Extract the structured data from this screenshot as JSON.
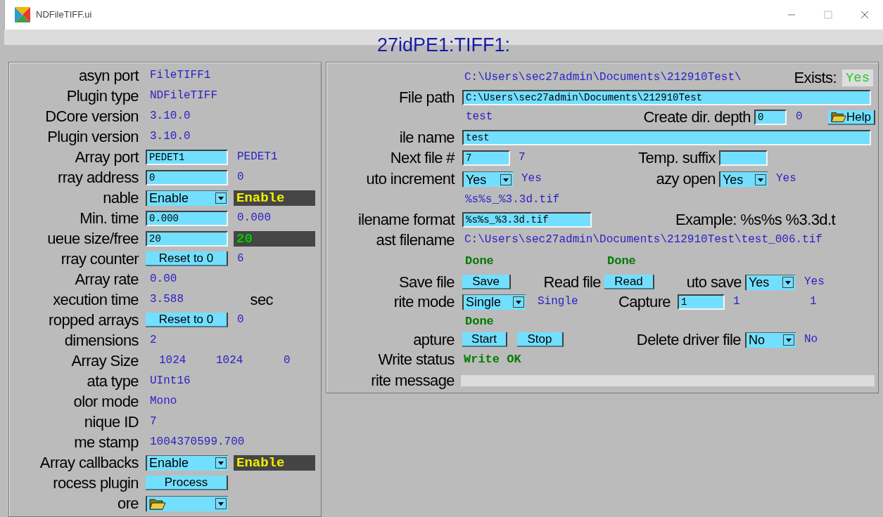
{
  "window": {
    "title": "NDFileTIFF.ui"
  },
  "header": {
    "text": "27idPE1:TIFF1:"
  },
  "left_panel": {
    "rows": [
      {
        "label": "asyn port",
        "items": [
          {
            "kind": "readback",
            "text": "FileTIFF1"
          }
        ]
      },
      {
        "label": "Plugin type",
        "items": [
          {
            "kind": "readback",
            "text": "NDFileTIFF"
          }
        ]
      },
      {
        "label": "DCore version",
        "items": [
          {
            "kind": "readback",
            "text": "3.10.0"
          }
        ]
      },
      {
        "label": "Plugin version",
        "items": [
          {
            "kind": "readback",
            "text": "3.10.0"
          }
        ]
      },
      {
        "label": "Array port",
        "items": [
          {
            "kind": "input",
            "value": "PEDET1"
          },
          {
            "kind": "readback",
            "text": "PEDET1"
          }
        ]
      },
      {
        "label": "rray address",
        "items": [
          {
            "kind": "input",
            "value": "0"
          },
          {
            "kind": "readback",
            "text": "0"
          }
        ]
      },
      {
        "label": "nable",
        "items": [
          {
            "kind": "menu",
            "value": "Enable"
          },
          {
            "kind": "dark",
            "text": "Enable",
            "color": "#f0f000"
          }
        ]
      },
      {
        "label": "Min. time",
        "items": [
          {
            "kind": "input",
            "value": "0.000"
          },
          {
            "kind": "readback",
            "text": "0.000"
          }
        ]
      },
      {
        "label": "ueue size/free",
        "items": [
          {
            "kind": "input",
            "value": "20"
          },
          {
            "kind": "dark",
            "text": "20",
            "color": "#00c800"
          }
        ]
      },
      {
        "label": "rray counter",
        "items": [
          {
            "kind": "button",
            "text": "Reset to 0"
          },
          {
            "kind": "readback",
            "text": "6"
          }
        ]
      },
      {
        "label": "Array rate",
        "items": [
          {
            "kind": "readback",
            "text": "0.00"
          }
        ]
      },
      {
        "label": "xecution time",
        "items": [
          {
            "kind": "readback",
            "text": "3.588"
          },
          {
            "kind": "label",
            "text": "sec"
          }
        ]
      },
      {
        "label": "ropped arrays",
        "items": [
          {
            "kind": "button",
            "text": "Reset to 0"
          },
          {
            "kind": "readback",
            "text": "0"
          }
        ]
      },
      {
        "label": "dimensions",
        "items": [
          {
            "kind": "readback",
            "text": "2"
          }
        ]
      },
      {
        "label": "Array Size",
        "items": [
          {
            "kind": "readback",
            "text": "1024"
          },
          {
            "kind": "readback",
            "text": "1024"
          },
          {
            "kind": "readback",
            "text": "0"
          }
        ]
      },
      {
        "label": "ata type",
        "items": [
          {
            "kind": "readback",
            "text": "UInt16"
          }
        ]
      },
      {
        "label": "olor mode",
        "items": [
          {
            "kind": "readback",
            "text": "Mono"
          }
        ]
      },
      {
        "label": "nique ID",
        "items": [
          {
            "kind": "readback",
            "text": "7"
          }
        ]
      },
      {
        "label": "me stamp",
        "items": [
          {
            "kind": "readback",
            "text": "1004370599.700"
          }
        ]
      },
      {
        "label": "Array callbacks",
        "items": [
          {
            "kind": "menu",
            "value": "Enable"
          },
          {
            "kind": "dark",
            "text": "Enable",
            "color": "#f0f000"
          }
        ]
      },
      {
        "label": "rocess plugin",
        "items": [
          {
            "kind": "button",
            "text": "Process"
          }
        ]
      },
      {
        "label": "ore",
        "items": [
          {
            "kind": "folder-menu"
          }
        ]
      }
    ]
  },
  "right_panel": {
    "rows": [
      {
        "label": "",
        "items": [
          {
            "kind": "readback",
            "text": "C:\\Users\\sec27admin\\Documents\\212910Test\\"
          },
          {
            "kind": "label",
            "text": "Exists:"
          },
          {
            "kind": "indicator",
            "text": "Yes"
          }
        ]
      },
      {
        "label": "File path",
        "items": [
          {
            "kind": "input",
            "value": "C:\\Users\\sec27admin\\Documents\\212910Test"
          }
        ]
      },
      {
        "label": "",
        "items": [
          {
            "kind": "readback",
            "text": "test"
          },
          {
            "kind": "label",
            "text": "Create dir. depth"
          },
          {
            "kind": "input",
            "value": "0"
          },
          {
            "kind": "readback",
            "text": "0"
          },
          {
            "kind": "help-button",
            "text": "Help"
          }
        ]
      },
      {
        "label": "ile name",
        "items": [
          {
            "kind": "input",
            "value": "test"
          }
        ]
      },
      {
        "label": "Next file #",
        "items": [
          {
            "kind": "input",
            "value": "7"
          },
          {
            "kind": "readback",
            "text": "7"
          },
          {
            "kind": "label",
            "text": "Temp. suffix"
          },
          {
            "kind": "input",
            "value": ""
          }
        ]
      },
      {
        "label": "uto increment",
        "items": [
          {
            "kind": "menu",
            "value": "Yes"
          },
          {
            "kind": "readback",
            "text": "Yes"
          },
          {
            "kind": "label",
            "text": "azy open"
          },
          {
            "kind": "menu",
            "value": "Yes"
          },
          {
            "kind": "readback",
            "text": "Yes"
          }
        ]
      },
      {
        "label": "",
        "items": [
          {
            "kind": "readback",
            "text": "%s%s_%3.3d.tif"
          }
        ]
      },
      {
        "label": "ilename format",
        "items": [
          {
            "kind": "input",
            "value": "%s%s_%3.3d.tif"
          },
          {
            "kind": "label",
            "text": "Example: %s%s  %3.3d.t"
          }
        ]
      },
      {
        "label": "ast filename",
        "items": [
          {
            "kind": "readback",
            "text": "C:\\Users\\sec27admin\\Documents\\212910Test\\test_006.tif"
          }
        ]
      },
      {
        "label": "",
        "items": [
          {
            "kind": "status",
            "text": "Done"
          },
          {
            "kind": "status",
            "text": "Done"
          }
        ]
      },
      {
        "label": "Save file",
        "items": [
          {
            "kind": "button",
            "text": "Save"
          },
          {
            "kind": "label",
            "text": "Read file"
          },
          {
            "kind": "button",
            "text": "Read"
          },
          {
            "kind": "label",
            "text": "uto save"
          },
          {
            "kind": "menu",
            "value": "Yes"
          },
          {
            "kind": "readback",
            "text": "Yes"
          }
        ]
      },
      {
        "label": "rite mode",
        "items": [
          {
            "kind": "menu",
            "value": "Single"
          },
          {
            "kind": "readback",
            "text": "Single"
          },
          {
            "kind": "label",
            "text": "Capture"
          },
          {
            "kind": "input",
            "value": "1"
          },
          {
            "kind": "readback",
            "text": "1"
          },
          {
            "kind": "readback",
            "text": "1"
          }
        ]
      },
      {
        "label": "",
        "items": [
          {
            "kind": "status",
            "text": "Done"
          }
        ]
      },
      {
        "label": "apture",
        "items": [
          {
            "kind": "button",
            "text": "Start"
          },
          {
            "kind": "button",
            "text": "Stop"
          },
          {
            "kind": "label",
            "text": "Delete driver file"
          },
          {
            "kind": "menu",
            "value": "No"
          },
          {
            "kind": "readback",
            "text": "No"
          }
        ]
      },
      {
        "label": "Write status",
        "items": [
          {
            "kind": "status",
            "text": "Write OK"
          }
        ]
      },
      {
        "label": "rite message",
        "items": [
          {
            "kind": "bar"
          }
        ]
      }
    ]
  }
}
